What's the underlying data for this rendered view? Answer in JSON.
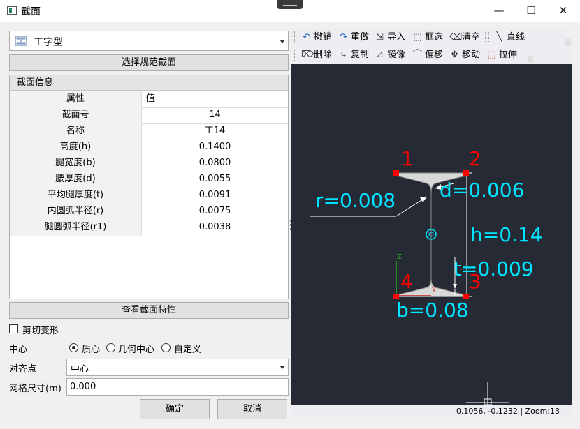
{
  "window": {
    "title": "截面",
    "minimize": "—",
    "maximize": "☐",
    "close": "✕"
  },
  "section_type": {
    "value": "工字型"
  },
  "buttons": {
    "select_standard": "选择规范截面",
    "view_props": "查看截面特性",
    "ok": "确定",
    "cancel": "取消"
  },
  "info": {
    "title": "截面信息",
    "col_prop": "属性",
    "col_value": "值",
    "rows": [
      {
        "label": "截面号",
        "value": "14"
      },
      {
        "label": "名称",
        "value": "工14"
      },
      {
        "label": "高度(h)",
        "value": "0.1400"
      },
      {
        "label": "腿宽度(b)",
        "value": "0.0800"
      },
      {
        "label": "腰厚度(d)",
        "value": "0.0055"
      },
      {
        "label": "平均腿厚度(t)",
        "value": "0.0091"
      },
      {
        "label": "内圆弧半径(r)",
        "value": "0.0075"
      },
      {
        "label": "腿圆弧半径(r1)",
        "value": "0.0038"
      }
    ]
  },
  "shear": {
    "label": "剪切变形",
    "checked": false
  },
  "center": {
    "label": "中心",
    "options": [
      "质心",
      "几何中心",
      "自定义"
    ],
    "selected": "质心"
  },
  "align": {
    "label": "对齐点",
    "value": "中心"
  },
  "mesh": {
    "label": "网格尺寸(m)",
    "value": "0.000"
  },
  "toolbar": {
    "row1": [
      {
        "label": "撤销",
        "icon": "undo-icon"
      },
      {
        "label": "重做",
        "icon": "redo-icon"
      },
      {
        "label": "导入",
        "icon": "import-icon"
      },
      {
        "label": "框选",
        "icon": "box-select-icon"
      },
      {
        "label": "清空",
        "icon": "clear-icon"
      },
      {
        "label": "直线",
        "icon": "line-icon"
      }
    ],
    "row2": [
      {
        "label": "删除",
        "icon": "delete-icon"
      },
      {
        "label": "复制",
        "icon": "copy-icon"
      },
      {
        "label": "镜像",
        "icon": "mirror-icon"
      },
      {
        "label": "偏移",
        "icon": "offset-icon"
      },
      {
        "label": "移动",
        "icon": "move-icon"
      },
      {
        "label": "拉伸",
        "icon": "stretch-icon"
      }
    ]
  },
  "drawing": {
    "corners": [
      "1",
      "2",
      "3",
      "4"
    ],
    "dims": {
      "r": "r=0.008",
      "d": "d=0.006",
      "h": "h=0.14",
      "t": "t=0.009",
      "b": "b=0.08"
    },
    "axes": {
      "z": "Z",
      "y": "Y"
    },
    "colors": {
      "background": "#252a34",
      "dimension": "#00e5ff",
      "corner": "#ff0000",
      "section": "#d8d8d8"
    }
  },
  "status": "0.1056, -0.1232 | Zoom:13"
}
